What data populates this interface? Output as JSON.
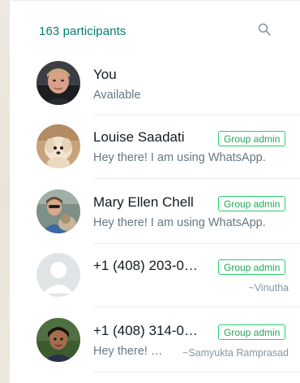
{
  "header": {
    "participants_label": "163 participants",
    "search_icon": "search-icon"
  },
  "participants": [
    {
      "name": "You",
      "status": "Available",
      "admin_badge": "",
      "pushname": ""
    },
    {
      "name": "Louise Saadati",
      "status": "Hey there! I am using WhatsApp.",
      "admin_badge": "Group admin",
      "pushname": ""
    },
    {
      "name": "Mary Ellen Chell",
      "status": "Hey there! I am using WhatsApp.",
      "admin_badge": "Group admin",
      "pushname": ""
    },
    {
      "name": "+1 (408) 203-0…",
      "status": "",
      "admin_badge": "Group admin",
      "pushname": "~Vinutha"
    },
    {
      "name": "+1 (408) 314-0…",
      "status": "Hey there! …",
      "admin_badge": "Group admin",
      "pushname": "~Samyukta Ramprasad"
    }
  ],
  "colors": {
    "accent": "#008069",
    "badge_border": "#25d366",
    "badge_text": "#1fa855",
    "primary_text": "#111b21",
    "secondary_text": "#667781",
    "divider": "#e9edef"
  }
}
